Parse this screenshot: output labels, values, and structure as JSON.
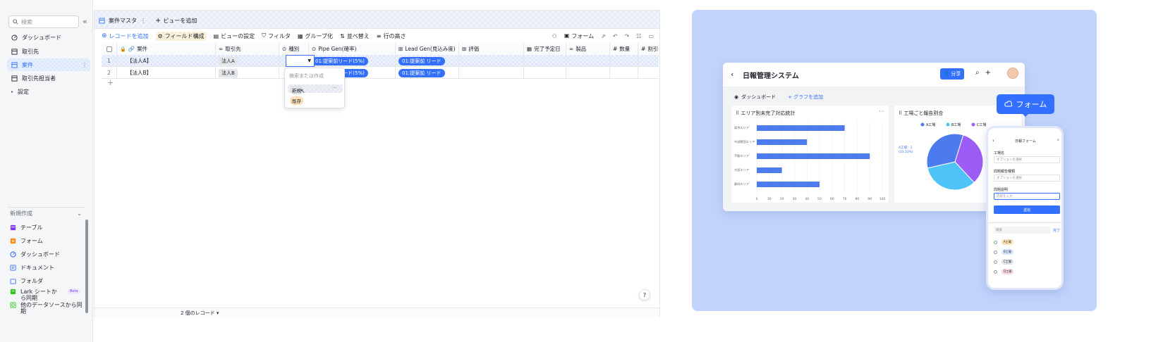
{
  "sidebar": {
    "search_placeholder": "検索",
    "items": [
      {
        "label": "ダッシュボード"
      },
      {
        "label": "取引先"
      },
      {
        "label": "案件"
      },
      {
        "label": "取引先担当者"
      },
      {
        "label": "設定"
      }
    ],
    "create_heading": "新規作成",
    "create_items": [
      {
        "label": "テーブル"
      },
      {
        "label": "フォーム"
      },
      {
        "label": "ダッシュボード"
      },
      {
        "label": "ドキュメント"
      },
      {
        "label": "フォルダ"
      },
      {
        "label": "Lark シートから同期",
        "badge": "Beta"
      },
      {
        "label": "他のデータソースから同期"
      }
    ]
  },
  "tabs": {
    "active": "案件マスタ",
    "add": "ビューを追加"
  },
  "toolbar": {
    "add_record": "レコードを追加",
    "field_config": "フィールド構成",
    "view_settings": "ビューの設定",
    "filter": "フィルタ",
    "group": "グループ化",
    "sort": "並べ替え",
    "row_height": "行の高さ",
    "form": "フォーム"
  },
  "table": {
    "columns": [
      "案件",
      "取引先",
      "種別",
      "Pipe Gen(確率)",
      "Lead Gen(見込み度)",
      "評価",
      "完了予定日",
      "製品",
      "数量",
      "割引"
    ],
    "rows": [
      {
        "num": "1",
        "deal": "【法人A】",
        "client": "法人A",
        "pipe": "01:提案前リード(5%)",
        "lead": "01:提案前 リード"
      },
      {
        "num": "2",
        "deal": "【法人B】",
        "client": "法人B",
        "pipe": "01:提案前リード(5%)",
        "lead": "01:提案前 リード"
      }
    ],
    "record_count": "2 個のレコード"
  },
  "dropdown": {
    "search_placeholder": "検索または作成",
    "options": [
      {
        "label": "新規",
        "color": "#dfe2e7"
      },
      {
        "label": "既存",
        "color": "#fbe2b9"
      }
    ]
  },
  "promo": {
    "app_title": "日報管理システム",
    "share": "分享",
    "dashboard_tab": "ダッシュボード",
    "add_graph": "グラフを追加",
    "form_callout": "フォーム",
    "bar_title": "エリア別未完了対応統計",
    "pie_title": "工場ごと報告割合",
    "pie_label": "A工場：1 (33.33%)",
    "phone": {
      "title": "日報フォーム",
      "f1_label": "工場名",
      "f1_value": "オプションを選択",
      "f2_label": "問題報告種類",
      "f2_value": "オプションを選択",
      "f3_label": "問題説明",
      "f3_value": "内容を入力",
      "send": "送信",
      "search": "検索",
      "done": "完了",
      "tags": [
        "A工場",
        "B工場",
        "C工場",
        "D工場"
      ]
    }
  },
  "chart_data": [
    {
      "type": "bar",
      "title": "エリア別未完了対応統計",
      "categories": [
        "東京エリア",
        "中部関西エリア",
        "不動エリア",
        "大阪エリア",
        "静岡エリア"
      ],
      "values": [
        70,
        40,
        90,
        20,
        50
      ],
      "xlim": [
        0,
        100
      ],
      "xticks": [
        "0",
        "10",
        "20",
        "30",
        "40",
        "50",
        "60",
        "70",
        "80",
        "90",
        "100"
      ],
      "orientation": "horizontal",
      "color": "#4b7bec"
    },
    {
      "type": "pie",
      "title": "工場ごと報告割合",
      "categories": [
        "A工場",
        "B工場",
        "C工場"
      ],
      "values": [
        1,
        1,
        1
      ],
      "colors": [
        "#4b7bec",
        "#4fc3f7",
        "#9c5cf5"
      ]
    }
  ]
}
